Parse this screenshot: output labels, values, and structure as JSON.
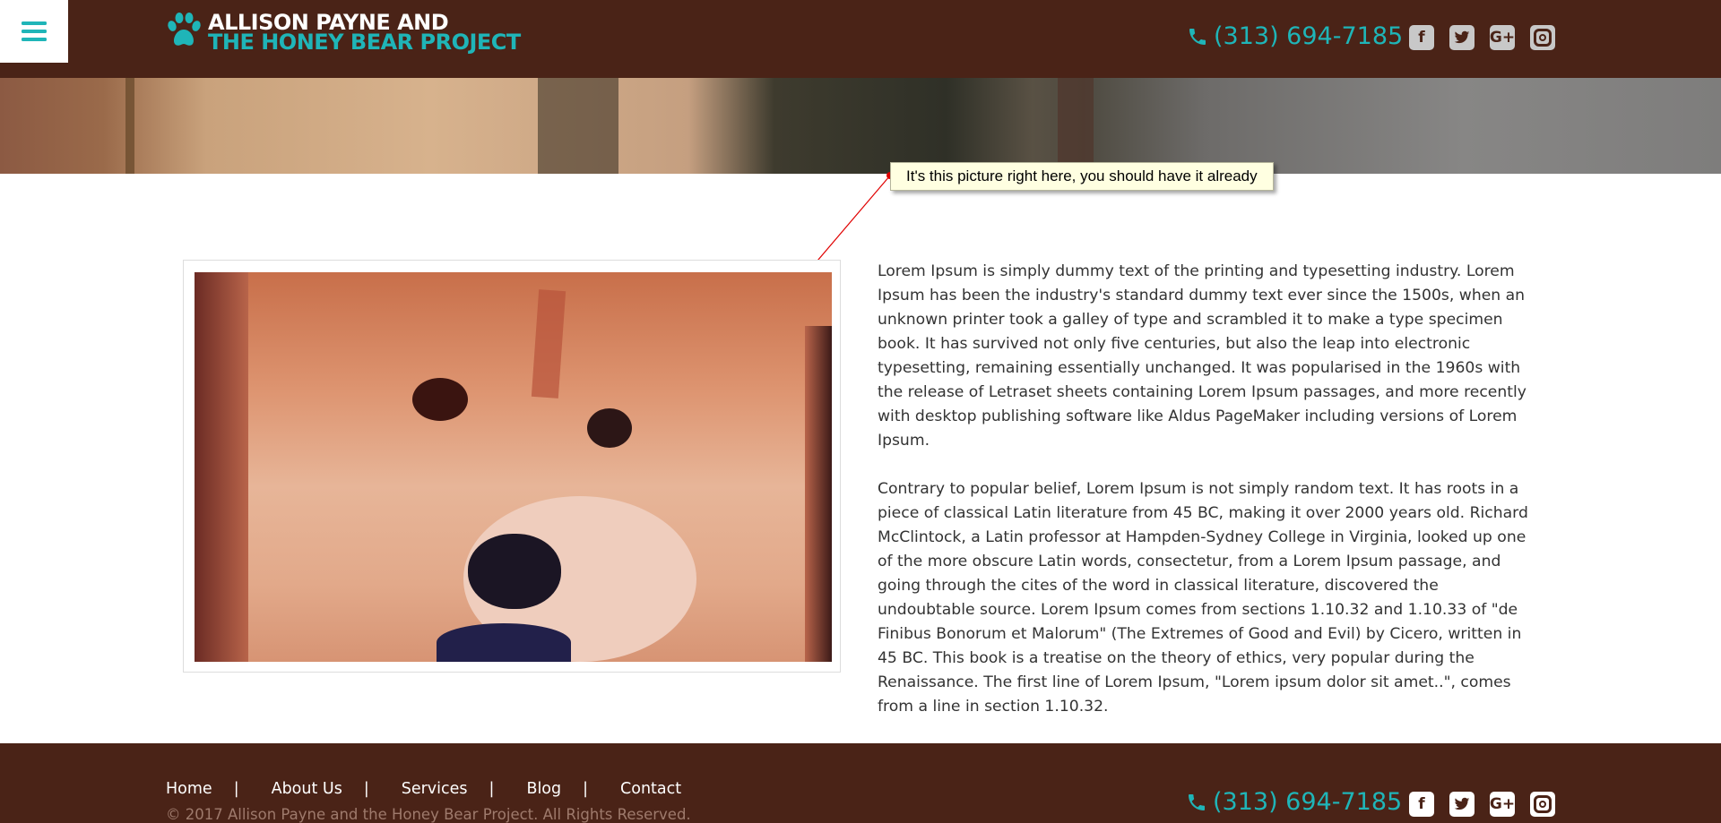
{
  "header": {
    "menu_icon": "hamburger-menu-icon",
    "logo": {
      "line1": "ALLISON PAYNE AND",
      "line2": "THE HONEY BEAR PROJECT",
      "icon": "paw-icon"
    },
    "phone": "(313) 694-7185",
    "social": [
      "facebook-icon",
      "twitter-icon",
      "google-plus-icon",
      "instagram-icon"
    ]
  },
  "annotation": {
    "text": "It's this picture right here, you should have it already"
  },
  "content": {
    "paragraphs": [
      "Lorem Ipsum is simply dummy text of the printing and typesetting industry. Lorem Ipsum has been the industry's standard dummy text ever since the 1500s, when an unknown printer took a galley of type and scrambled it to make a type specimen book. It has survived not only five centuries, but also the leap into electronic typesetting, remaining essentially unchanged. It was popularised in the 1960s with the release of Letraset sheets containing Lorem Ipsum passages, and more recently with desktop publishing software like Aldus PageMaker including versions of Lorem Ipsum.",
      "Contrary to popular belief, Lorem Ipsum is not simply random text. It has roots in a piece of classical Latin literature from 45 BC, making it over 2000 years old. Richard McClintock, a Latin professor at Hampden-Sydney College in Virginia, looked up one of the more obscure Latin words, consectetur, from a Lorem Ipsum passage, and going through the cites of the word in classical literature, discovered the undoubtable source. Lorem Ipsum comes from sections 1.10.32 and 1.10.33 of \"de Finibus Bonorum et Malorum\" (The Extremes of Good and Evil) by Cicero, written in 45 BC. This book is a treatise on the theory of ethics, very popular during the Renaissance. The first line of Lorem Ipsum, \"Lorem ipsum dolor sit amet..\", comes from a line in section 1.10.32."
    ]
  },
  "footer": {
    "nav": [
      "Home",
      "About Us",
      "Services",
      "Blog",
      "Contact"
    ],
    "separator": "|",
    "copyright": "© 2017 Allison Payne and the Honey Bear Project. All Rights Reserved.",
    "phone": "(313) 694-7185",
    "social": [
      "facebook-icon",
      "twitter-icon",
      "google-plus-icon",
      "instagram-icon"
    ]
  },
  "colors": {
    "header_bg": "#4a2317",
    "accent": "#1fb5b8",
    "annotation_bg": "#ffffe1",
    "arrow": "#e00000"
  }
}
